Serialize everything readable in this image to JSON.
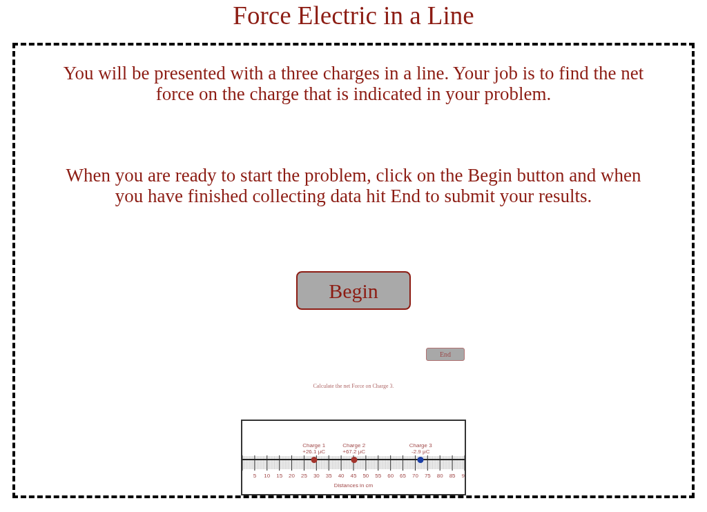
{
  "title": "Force Electric in a Line",
  "instructions": [
    "You will be presented with a three charges in a line. Your job is to find the net force on the charge that is indicated in your problem.",
    "When you are ready to start the problem, click on the Begin button and when you have finished collecting data hit End to submit your results."
  ],
  "begin_button": "Begin",
  "preview": {
    "end_button": "End",
    "prompt": "Calculate the net Force on Charge 3.",
    "ruler": {
      "charges": [
        {
          "name": "Charge 1",
          "value": "+26.1 μC",
          "color": "#a3342c",
          "level": 0.322
        },
        {
          "name": "Charge 2",
          "value": "+67.2 μC",
          "color": "#a3342c",
          "level": 0.502
        },
        {
          "name": "Charge 3",
          "value": "-2.9 μC",
          "color": "#1c3fa6",
          "level": 0.802
        }
      ],
      "tick_labels": [
        "5",
        "10",
        "15",
        "20",
        "25",
        "30",
        "35",
        "40",
        "45",
        "50",
        "55",
        "60",
        "65",
        "70",
        "75",
        "80",
        "85",
        "9"
      ],
      "axis_label": "Distances in cm"
    }
  }
}
